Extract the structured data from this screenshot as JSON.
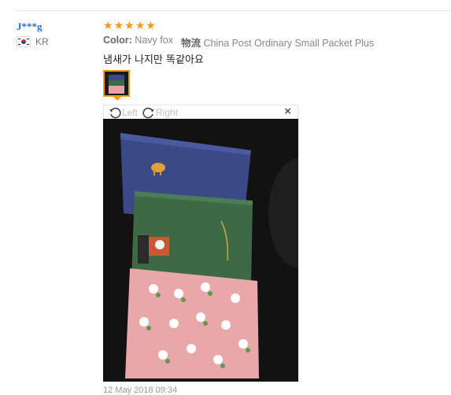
{
  "review": {
    "buyer": "J***g",
    "country_code": "KR",
    "rating": 5,
    "color_label": "Color:",
    "color_value": "Navy fox",
    "shipping_label": "物流",
    "shipping_value": "China Post Ordinary Small Packet Plus",
    "text": "냄새가 나지만 똑같아요",
    "date": "12 May 2018 09:34"
  },
  "viewer": {
    "rotate_left_label": "Left",
    "rotate_right_label": "Right",
    "close_symbol": "×"
  },
  "colors": {
    "name_link": "#2a6bd4",
    "star": "#f39a1b",
    "thumb_border": "#f39a1b"
  },
  "icons": [
    "korea-flag-icon",
    "star-icon",
    "rotate-left-icon",
    "rotate-right-icon",
    "close-icon"
  ]
}
